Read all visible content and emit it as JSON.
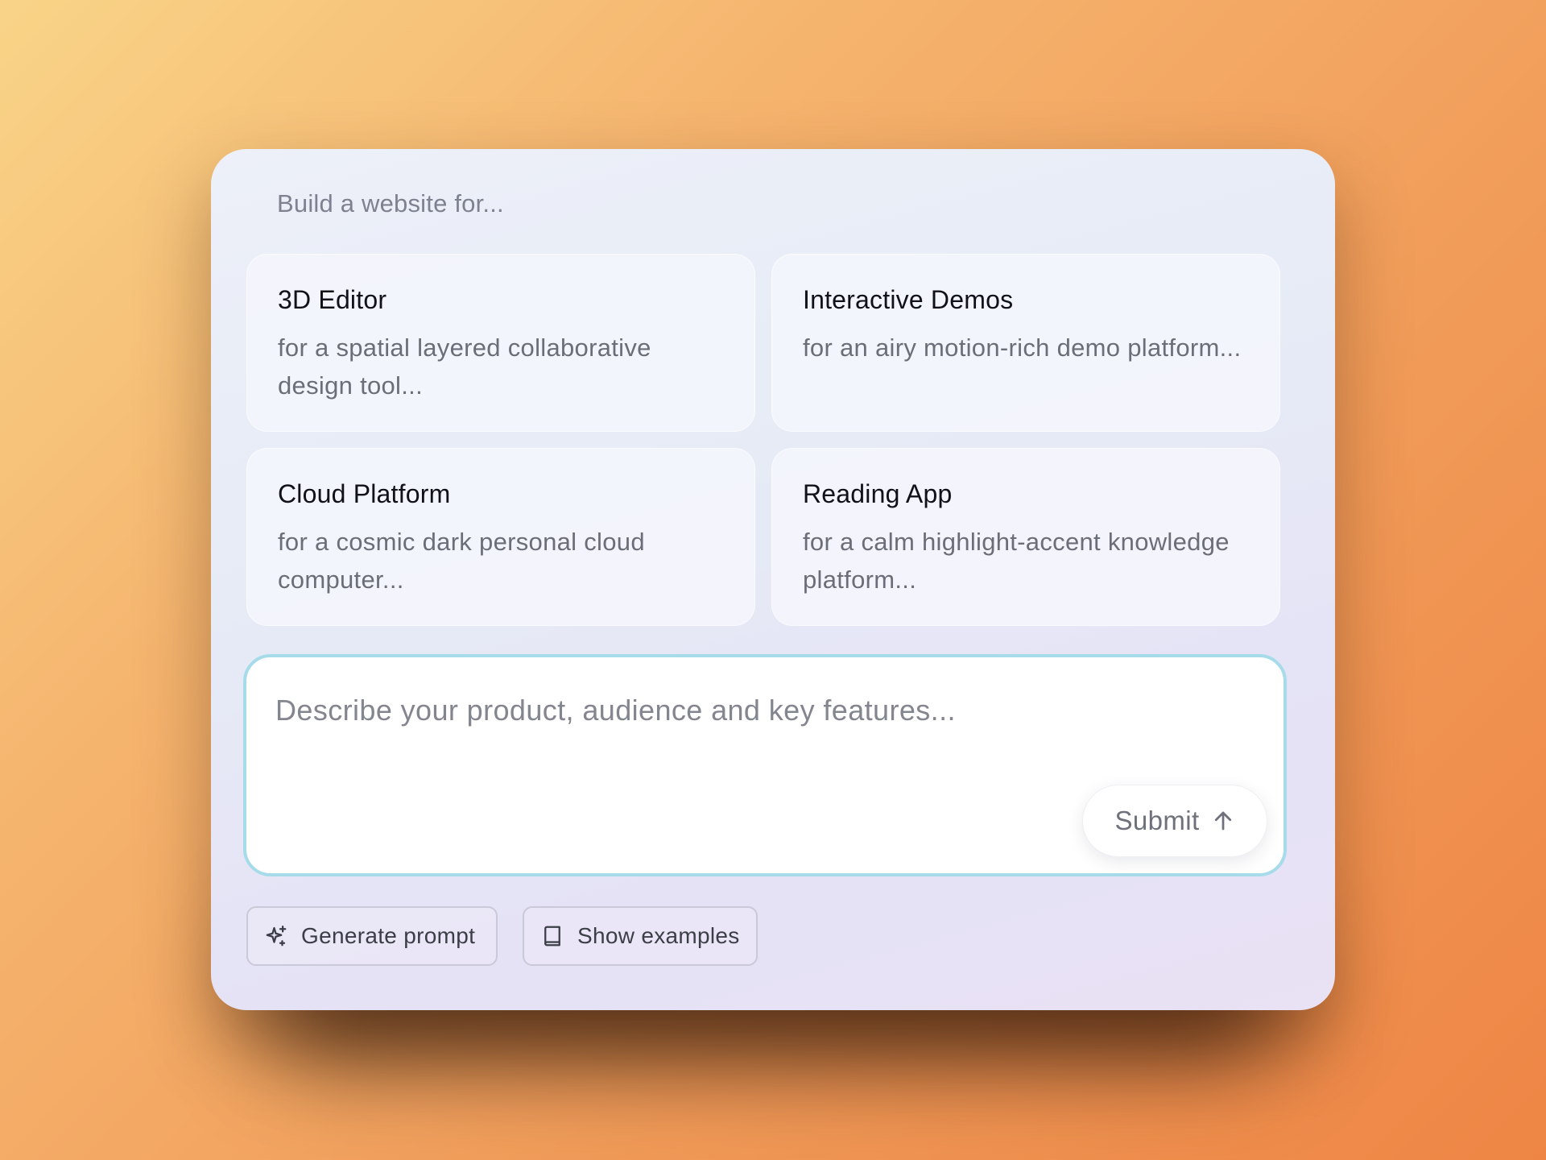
{
  "panel": {
    "heading": "Build a website for..."
  },
  "suggestions": [
    {
      "title": "3D Editor",
      "description": "for a spatial layered collaborative design tool..."
    },
    {
      "title": "Interactive Demos",
      "description": "for an airy motion-rich demo platform..."
    },
    {
      "title": "Cloud Platform",
      "description": "for a cosmic dark personal cloud computer..."
    },
    {
      "title": "Reading App",
      "description": "for a calm highlight-accent knowledge platform..."
    }
  ],
  "prompt": {
    "value": "",
    "placeholder": "Describe your product, audience and key features...",
    "submit_label": "Submit",
    "submit_icon": "arrow-up-icon"
  },
  "actions": {
    "generate_label": "Generate prompt",
    "generate_icon": "sparkles-icon",
    "examples_label": "Show examples",
    "examples_icon": "book-icon"
  },
  "colors": {
    "focus_border": "#a6dcea",
    "background_start": "#f9d488",
    "background_end": "#ee8545"
  }
}
